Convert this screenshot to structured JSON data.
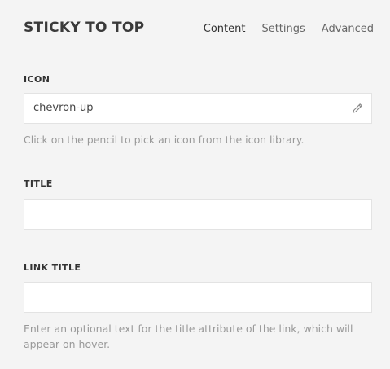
{
  "header": {
    "title": "STICKY TO TOP",
    "tabs": [
      {
        "label": "Content",
        "active": true
      },
      {
        "label": "Settings",
        "active": false
      },
      {
        "label": "Advanced",
        "active": false
      }
    ]
  },
  "icon_field": {
    "label": "ICON",
    "value": "chevron-up",
    "action_icon": "pencil-icon",
    "help": "Click on the pencil to pick an icon from the icon library."
  },
  "title_field": {
    "label": "TITLE",
    "value": ""
  },
  "link_title_field": {
    "label": "LINK TITLE",
    "value": "",
    "help": "Enter an optional text for the title attribute of the link, which will appear on hover."
  }
}
